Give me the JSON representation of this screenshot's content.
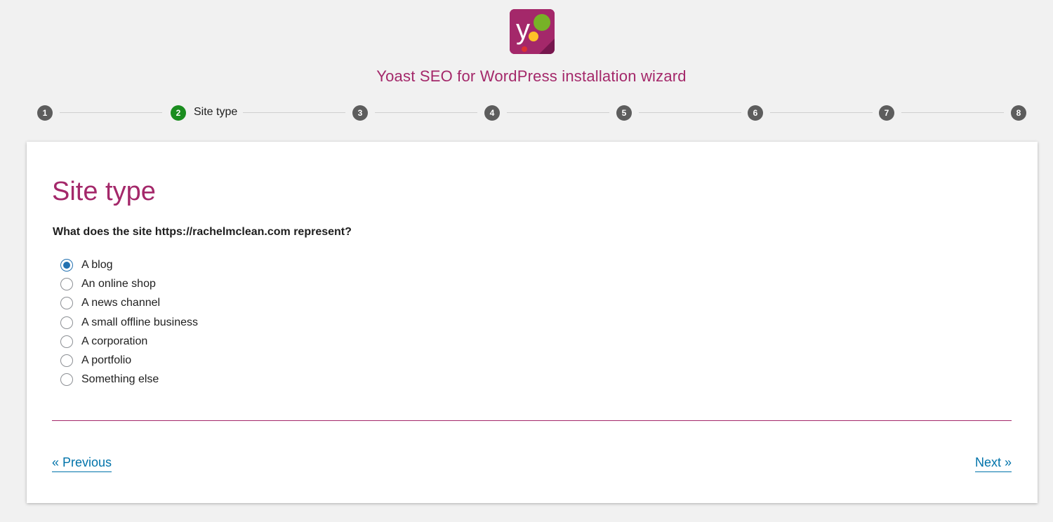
{
  "header": {
    "logo_icon": "yoast-logo-icon",
    "title": "Yoast SEO for WordPress installation wizard"
  },
  "stepper": {
    "steps": [
      "1",
      "2",
      "3",
      "4",
      "5",
      "6",
      "7",
      "8"
    ],
    "active_step": "2",
    "active_label": "Site type"
  },
  "card": {
    "title": "Site type",
    "question": "What does the site https://rachelmclean.com represent?",
    "options": [
      {
        "label": "A blog",
        "checked": true
      },
      {
        "label": "An online shop",
        "checked": false
      },
      {
        "label": "A news channel",
        "checked": false
      },
      {
        "label": "A small offline business",
        "checked": false
      },
      {
        "label": "A corporation",
        "checked": false
      },
      {
        "label": "A portfolio",
        "checked": false
      },
      {
        "label": "Something else",
        "checked": false
      }
    ],
    "previous_label": "« Previous",
    "next_label": "Next »"
  },
  "colors": {
    "brand": "#a4286a",
    "active_step": "#1a8d1f",
    "inactive_step": "#5d5d5d",
    "link": "#0073aa",
    "radio": "#2271b1"
  }
}
